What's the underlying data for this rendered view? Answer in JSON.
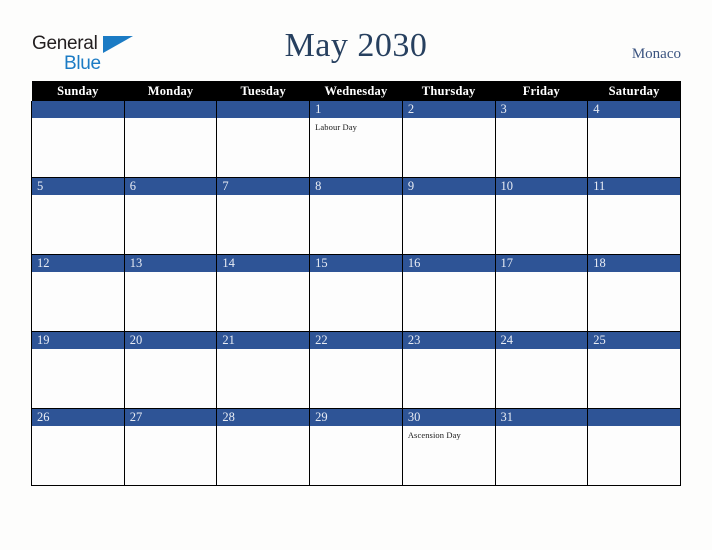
{
  "brand": {
    "name_top": "General",
    "name_bottom": "Blue",
    "triangle_icon": "triangle-icon",
    "color_dark": "#231f20",
    "color_blue": "#1b7bc4"
  },
  "header": {
    "title": "May 2030",
    "country": "Monaco",
    "title_color": "#27405f",
    "country_color": "#3b5480"
  },
  "calendar": {
    "month": "May",
    "year": "2030",
    "header_bg": "#000000",
    "header_text_color": "#ffffff",
    "daynum_bg": "#2e5496",
    "daynum_color": "#e8ecf4",
    "weekday_headers": [
      "Sunday",
      "Monday",
      "Tuesday",
      "Wednesday",
      "Thursday",
      "Friday",
      "Saturday"
    ],
    "weeks": [
      [
        {
          "day": "",
          "event": ""
        },
        {
          "day": "",
          "event": ""
        },
        {
          "day": "",
          "event": ""
        },
        {
          "day": "1",
          "event": "Labour Day"
        },
        {
          "day": "2",
          "event": ""
        },
        {
          "day": "3",
          "event": ""
        },
        {
          "day": "4",
          "event": ""
        }
      ],
      [
        {
          "day": "5",
          "event": ""
        },
        {
          "day": "6",
          "event": ""
        },
        {
          "day": "7",
          "event": ""
        },
        {
          "day": "8",
          "event": ""
        },
        {
          "day": "9",
          "event": ""
        },
        {
          "day": "10",
          "event": ""
        },
        {
          "day": "11",
          "event": ""
        }
      ],
      [
        {
          "day": "12",
          "event": ""
        },
        {
          "day": "13",
          "event": ""
        },
        {
          "day": "14",
          "event": ""
        },
        {
          "day": "15",
          "event": ""
        },
        {
          "day": "16",
          "event": ""
        },
        {
          "day": "17",
          "event": ""
        },
        {
          "day": "18",
          "event": ""
        }
      ],
      [
        {
          "day": "19",
          "event": ""
        },
        {
          "day": "20",
          "event": ""
        },
        {
          "day": "21",
          "event": ""
        },
        {
          "day": "22",
          "event": ""
        },
        {
          "day": "23",
          "event": ""
        },
        {
          "day": "24",
          "event": ""
        },
        {
          "day": "25",
          "event": ""
        }
      ],
      [
        {
          "day": "26",
          "event": ""
        },
        {
          "day": "27",
          "event": ""
        },
        {
          "day": "28",
          "event": ""
        },
        {
          "day": "29",
          "event": ""
        },
        {
          "day": "30",
          "event": "Ascension Day"
        },
        {
          "day": "31",
          "event": ""
        },
        {
          "day": "",
          "event": ""
        }
      ]
    ]
  }
}
